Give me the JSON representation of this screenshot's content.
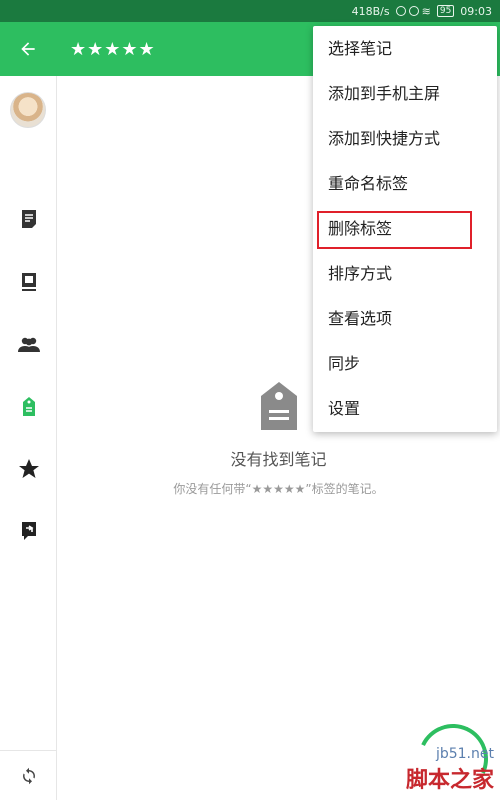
{
  "status_bar": {
    "speed": "418B/s",
    "battery": "95",
    "time": "09:03"
  },
  "app_bar": {
    "back_icon": "arrow-left-icon",
    "title": "★★★★★"
  },
  "colors": {
    "primary": "#2dbe60",
    "status_bar": "#1b7a3f",
    "highlight_border": "#e0202a"
  },
  "rail": {
    "items": [
      {
        "name": "notes",
        "icon": "note-icon"
      },
      {
        "name": "notebooks",
        "icon": "notebook-icon"
      },
      {
        "name": "shared",
        "icon": "people-icon"
      },
      {
        "name": "tags",
        "icon": "tag-icon",
        "active": true
      },
      {
        "name": "shortcuts",
        "icon": "star-icon"
      },
      {
        "name": "chat",
        "icon": "chat-icon"
      }
    ],
    "sync_icon": "sync-icon"
  },
  "empty_state": {
    "icon": "tag-icon",
    "title": "没有找到笔记",
    "subtitle": "你没有任何带“★★★★★”标签的笔记。"
  },
  "menu": {
    "items": [
      {
        "label": "选择笔记"
      },
      {
        "label": "添加到手机主屏"
      },
      {
        "label": "添加到快捷方式"
      },
      {
        "label": "重命名标签"
      },
      {
        "label": "删除标签",
        "highlighted": true
      },
      {
        "label": "排序方式"
      },
      {
        "label": "查看选项"
      },
      {
        "label": "同步"
      },
      {
        "label": "设置"
      }
    ]
  },
  "watermark": {
    "url": "jb51.net",
    "site": "脚本之家"
  }
}
